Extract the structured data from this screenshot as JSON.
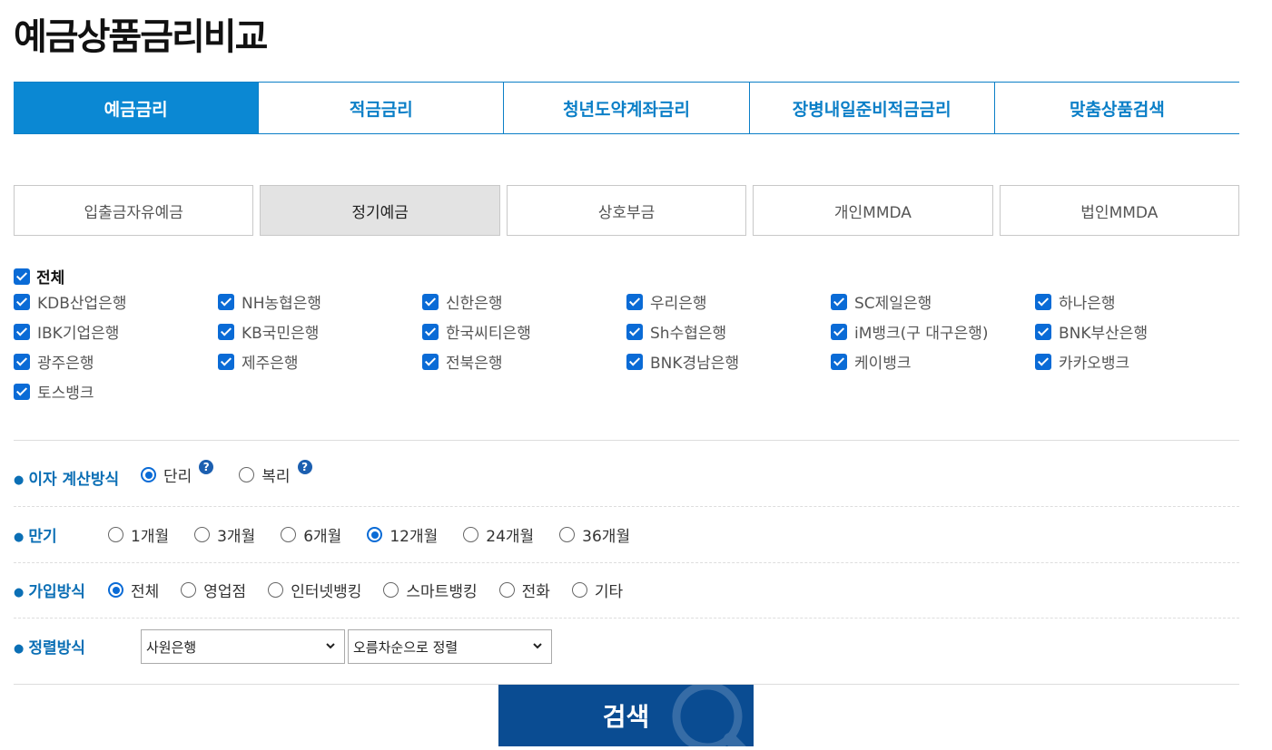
{
  "title": "예금상품금리비교",
  "main_tabs": [
    {
      "label": "예금금리",
      "active": true
    },
    {
      "label": "적금금리",
      "active": false
    },
    {
      "label": "청년도약계좌금리",
      "active": false
    },
    {
      "label": "장병내일준비적금금리",
      "active": false
    },
    {
      "label": "맞춤상품검색",
      "active": false
    }
  ],
  "sub_tabs": [
    {
      "label": "입출금자유예금",
      "active": false
    },
    {
      "label": "정기예금",
      "active": true
    },
    {
      "label": "상호부금",
      "active": false
    },
    {
      "label": "개인MMDA",
      "active": false
    },
    {
      "label": "법인MMDA",
      "active": false
    }
  ],
  "banks": {
    "all_label": "전체",
    "all_checked": true,
    "items": [
      "KDB산업은행",
      "NH농협은행",
      "신한은행",
      "우리은행",
      "SC제일은행",
      "하나은행",
      "IBK기업은행",
      "KB국민은행",
      "한국씨티은행",
      "Sh수협은행",
      "iM뱅크(구 대구은행)",
      "BNK부산은행",
      "광주은행",
      "제주은행",
      "전북은행",
      "BNK경남은행",
      "케이뱅크",
      "카카오뱅크",
      "토스뱅크"
    ]
  },
  "interest": {
    "label": "이자 계산방식",
    "options": [
      {
        "label": "단리",
        "selected": true
      },
      {
        "label": "복리",
        "selected": false
      }
    ],
    "help": "?"
  },
  "term": {
    "label": "만기",
    "options": [
      {
        "label": "1개월",
        "selected": false
      },
      {
        "label": "3개월",
        "selected": false
      },
      {
        "label": "6개월",
        "selected": false
      },
      {
        "label": "12개월",
        "selected": true
      },
      {
        "label": "24개월",
        "selected": false
      },
      {
        "label": "36개월",
        "selected": false
      }
    ]
  },
  "join": {
    "label": "가입방식",
    "options": [
      {
        "label": "전체",
        "selected": true
      },
      {
        "label": "영업점",
        "selected": false
      },
      {
        "label": "인터넷뱅킹",
        "selected": false
      },
      {
        "label": "스마트뱅킹",
        "selected": false
      },
      {
        "label": "전화",
        "selected": false
      },
      {
        "label": "기타",
        "selected": false
      }
    ]
  },
  "sort": {
    "label": "정렬방식",
    "select1": "사원은행",
    "select2": "오름차순으로 정렬"
  },
  "search_label": "검색",
  "colors": {
    "accent": "#0b88d3",
    "button": "#0a4c92",
    "label": "#0b6fb5"
  }
}
